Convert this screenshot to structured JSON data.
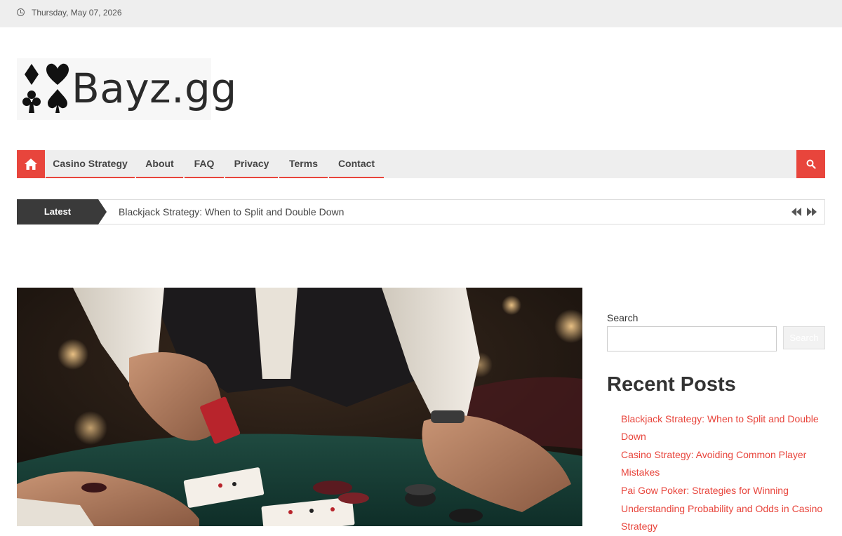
{
  "topbar": {
    "date": "Thursday, May 07, 2026",
    "icon": "clock-icon"
  },
  "logo": {
    "text": "Bayz.gg",
    "icon": "card-suits-logo"
  },
  "nav": {
    "home_icon": "home-icon",
    "items": [
      {
        "label": "Casino Strategy"
      },
      {
        "label": "About"
      },
      {
        "label": "FAQ"
      },
      {
        "label": "Privacy"
      },
      {
        "label": "Terms"
      },
      {
        "label": "Contact"
      }
    ],
    "search_icon": "search-icon"
  },
  "ticker": {
    "label": "Latest",
    "headline": "Blackjack Strategy: When to Split and Double Down",
    "prev_icon": "rewind-icon",
    "next_icon": "fast-forward-icon"
  },
  "hero": {
    "image": "casino-dealer-cards-photo"
  },
  "sidebar": {
    "search_label": "Search",
    "search_value": "",
    "search_button": "Search",
    "recent_title": "Recent Posts",
    "recent_posts": [
      {
        "title": "Blackjack Strategy: When to Split and Double Down"
      },
      {
        "title": "Casino Strategy: Avoiding Common Player Mistakes"
      },
      {
        "title": "Pai Gow Poker: Strategies for Winning"
      },
      {
        "title": "Understanding Probability and Odds in Casino Strategy"
      }
    ]
  },
  "colors": {
    "accent": "#e8453c",
    "dark": "#3a3a3a",
    "bar": "#eeeeee"
  }
}
